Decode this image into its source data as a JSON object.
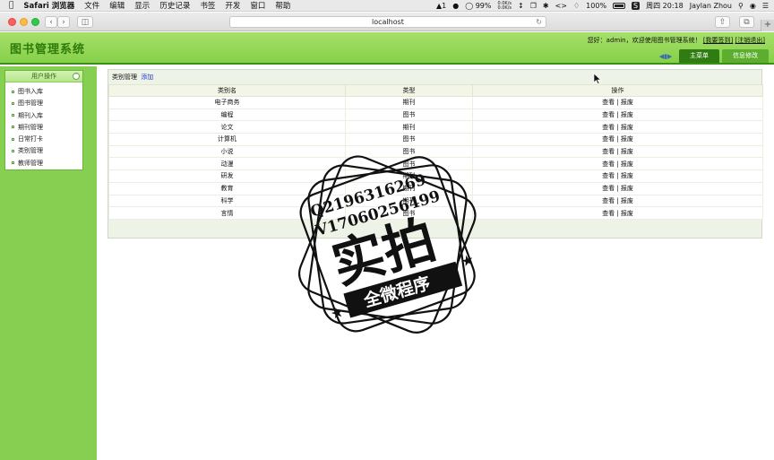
{
  "os_menubar": {
    "app_name": "Safari 浏览器",
    "menus": [
      "文件",
      "编辑",
      "显示",
      "历史记录",
      "书签",
      "开发",
      "窗口",
      "帮助"
    ],
    "status": {
      "notification_count": "1",
      "cpu_percent": "99%",
      "net_up": "0.0K/s",
      "net_down": "0.0K/s",
      "battery_percent": "100%",
      "clock": "周四 20:18",
      "user": "Jaylan Zhou"
    }
  },
  "browser": {
    "url": "localhost"
  },
  "app": {
    "logo_text": "图书管理系统",
    "welcome_text": "您好：admin，欢迎使用图书管理系统！",
    "signin_link": "[我要签到]",
    "logout_link": "[注销退出]",
    "top_tabs": [
      "主菜单",
      "信息修改"
    ]
  },
  "sidebar": {
    "title": "用户操作",
    "items": [
      "图书入库",
      "图书管理",
      "期刊入库",
      "期刊管理",
      "日常打卡",
      "类别管理",
      "教师管理"
    ]
  },
  "content": {
    "breadcrumb": "类别管理",
    "add_link": "添加",
    "columns": [
      "类别名",
      "类型",
      "操作"
    ],
    "rows": [
      {
        "name": "电子商务",
        "type": "期刊",
        "actions": "查看 | 报废"
      },
      {
        "name": "编程",
        "type": "图书",
        "actions": "查看 | 报废"
      },
      {
        "name": "论文",
        "type": "期刊",
        "actions": "查看 | 报废"
      },
      {
        "name": "计算机",
        "type": "图书",
        "actions": "查看 | 报废"
      },
      {
        "name": "小说",
        "type": "图书",
        "actions": "查看 | 报废"
      },
      {
        "name": "动漫",
        "type": "图书",
        "actions": "查看 | 报废"
      },
      {
        "name": "研发",
        "type": "期刊",
        "actions": "查看 | 报废"
      },
      {
        "name": "教育",
        "type": "期刊",
        "actions": "查看 | 报废"
      },
      {
        "name": "科学",
        "type": "期刊",
        "actions": "查看 | 报废"
      },
      {
        "name": "言情",
        "type": "图书",
        "actions": "查看 | 报废"
      }
    ]
  },
  "watermark": {
    "line1": "Q2196316269",
    "line2": "V17060256499",
    "big": "实拍",
    "banner": "全微程序"
  },
  "colors": {
    "header_green": "#86d04a",
    "sidebar_green": "#86cf50",
    "active_tab": "#2f7d12",
    "link_blue": "#1a3bcf"
  }
}
